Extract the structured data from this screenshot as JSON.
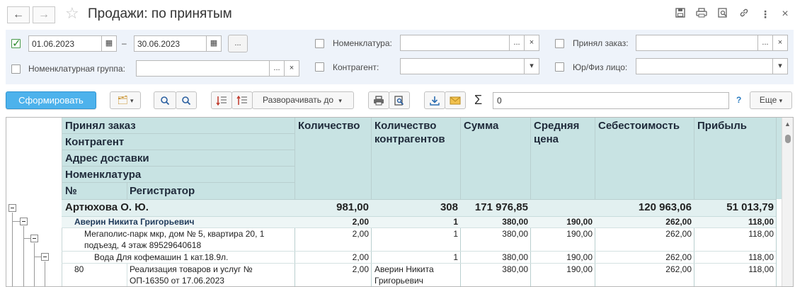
{
  "window": {
    "title": "Продажи: по принятым"
  },
  "filters": {
    "period_enabled": true,
    "date_from": "01.06.2023",
    "date_dash": "–",
    "date_to": "30.06.2023",
    "period_btn": "...",
    "nomenclature_group_label": "Номенклатурная группа:",
    "nomenclature_label": "Номенклатура:",
    "counterparty_label": "Контрагент:",
    "accepted_order_label": "Принял заказ:",
    "legal_label": "Юр/Физ лицо:",
    "dots": "...",
    "clear": "×"
  },
  "toolbar": {
    "generate_label": "Сформировать",
    "expand_label": "Разворачивать до",
    "sum_value": "0",
    "help": "?",
    "more_label": "Еще"
  },
  "report": {
    "row_headers": [
      "Принял заказ",
      "Контрагент",
      "Адрес доставки",
      "Номенклатура"
    ],
    "num_header": "№",
    "registrar_header": "Регистратор",
    "columns": [
      "Количество",
      "Количество контрагентов",
      "Сумма",
      "Средняя цена",
      "Себестоимость",
      "Прибыль"
    ],
    "rows": [
      {
        "level": 0,
        "name": "Артюхова О. Ю.",
        "values": [
          "981,00",
          "308",
          "171 976,85",
          "",
          "120 963,06",
          "51 013,79"
        ]
      },
      {
        "level": 1,
        "name": "Аверин Никита Григорьевич",
        "values": [
          "2,00",
          "1",
          "380,00",
          "190,00",
          "262,00",
          "118,00"
        ]
      },
      {
        "level": 2,
        "name_line1": "Мегаполис-парк мкр,  дом № 5,  квартира 20, 1",
        "name_line2": "подъезд, 4 этаж 89529640618",
        "values": [
          "2,00",
          "1",
          "380,00",
          "190,00",
          "262,00",
          "118,00"
        ]
      },
      {
        "level": 3,
        "name": "Вода Для кофемашин 1 кат.18.9л.",
        "values": [
          "2,00",
          "1",
          "380,00",
          "190,00",
          "262,00",
          "118,00"
        ]
      },
      {
        "level": 4,
        "num": "80",
        "name_line1": "Реализация товаров и услуг №",
        "name_line2": "ОП-16350 от 17.06.2023",
        "values": [
          "2,00",
          "Аверин Никита",
          "380,00",
          "190,00",
          "262,00",
          "118,00"
        ],
        "cnt_line2": "Григорьевич"
      }
    ]
  },
  "colors": {
    "header_bg": "#c8e3e3",
    "group_row_bg": "#e2f0f0",
    "accent_button": "#4db2ec"
  }
}
